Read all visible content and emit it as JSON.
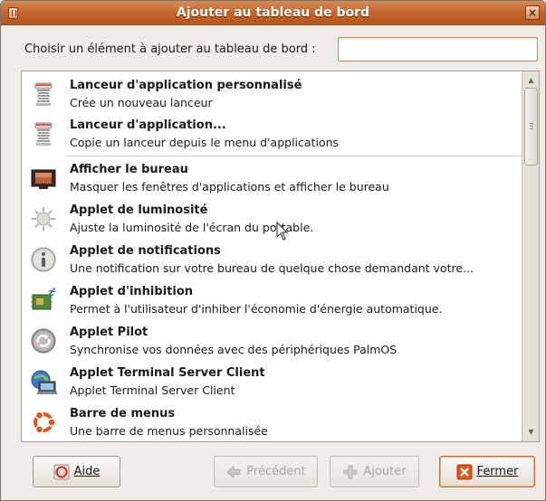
{
  "window": {
    "title": "Ajouter au tableau de bord",
    "close_glyph": "×"
  },
  "prompt": {
    "label": "Choisir un élément à ajouter au tableau de bord :",
    "search_value": ""
  },
  "items": [
    {
      "name": "Lanceur d'application personnalisé",
      "desc": "Crée un nouveau lanceur",
      "icon": "spring-launcher-icon"
    },
    {
      "name": "Lanceur d'application...",
      "desc": "Copie un lanceur depuis le menu d'applications",
      "icon": "spring-launcher-icon"
    },
    {
      "name": "Afficher le bureau",
      "desc": "Masquer les fenêtres d'applications et afficher le bureau",
      "icon": "show-desktop-icon"
    },
    {
      "name": "Applet de luminosité",
      "desc": "Ajuste la luminosité de l'écran du portable.",
      "icon": "brightness-icon"
    },
    {
      "name": "Applet de notifications",
      "desc": "Une notification sur votre bureau de quelque chose demandant votre...",
      "icon": "info-icon"
    },
    {
      "name": "Applet d'inhibition",
      "desc": "Permet à l'utilisateur d'inhiber l'économie d'énergie automatique.",
      "icon": "inhibit-icon"
    },
    {
      "name": "Applet Pilot",
      "desc": "Synchronise vos données avec des périphériques PalmOS",
      "icon": "pilot-sync-icon"
    },
    {
      "name": "Applet Terminal Server Client",
      "desc": "Applet Terminal Server Client",
      "icon": "terminal-server-icon"
    },
    {
      "name": "Barre de menus",
      "desc": "Une barre de menus personnalisée",
      "icon": "ubuntu-logo-icon"
    }
  ],
  "buttons": {
    "help": "Aide",
    "back": "Précédent",
    "add": "Ajouter",
    "close": "Fermer"
  },
  "colors": {
    "titlebar": "#c2622a",
    "accent": "#d36a2e"
  }
}
